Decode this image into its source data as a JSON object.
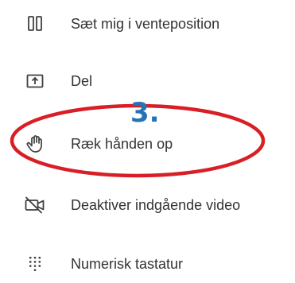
{
  "menu": {
    "items": [
      {
        "label": "Sæt mig i venteposition",
        "icon": "pause-icon"
      },
      {
        "label": "Del",
        "icon": "share-screen-icon"
      },
      {
        "label": "Ræk hånden op",
        "icon": "raise-hand-icon"
      },
      {
        "label": "Deaktiver indgående video",
        "icon": "video-off-icon"
      },
      {
        "label": "Numerisk tastatur",
        "icon": "dialpad-icon"
      }
    ]
  },
  "annotation": {
    "step_label": "3.",
    "highlight_color": "#d91f26",
    "label_color": "#2573b7"
  }
}
